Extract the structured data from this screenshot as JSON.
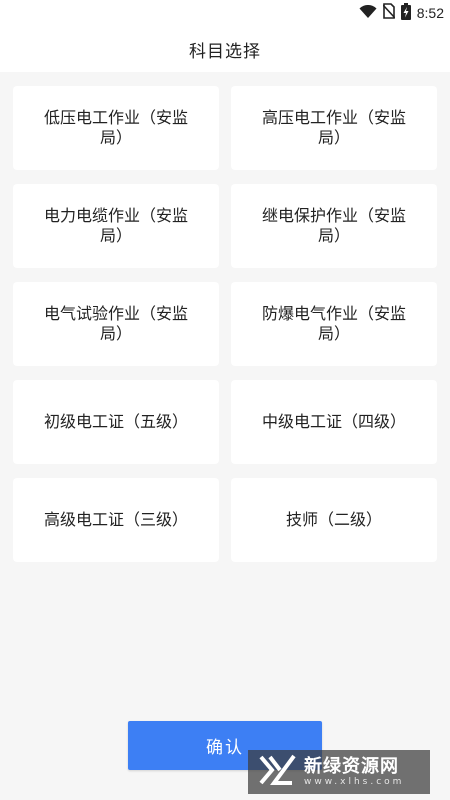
{
  "status_bar": {
    "time": "8:52",
    "icons": [
      "wifi-icon",
      "no-sim-icon",
      "battery-charging-icon"
    ]
  },
  "header": {
    "title": "科目选择"
  },
  "subjects": [
    {
      "label": "低压电工作业（安监局）"
    },
    {
      "label": "高压电工作业（安监局）"
    },
    {
      "label": "电力电缆作业（安监局）"
    },
    {
      "label": "继电保护作业（安监局）"
    },
    {
      "label": "电气试验作业（安监局）"
    },
    {
      "label": "防爆电气作业（安监局）"
    },
    {
      "label": "初级电工证（五级）"
    },
    {
      "label": "中级电工证（四级）"
    },
    {
      "label": "高级电工证（三级）"
    },
    {
      "label": "技师（二级）"
    }
  ],
  "confirm": {
    "label": "确认"
  },
  "watermark": {
    "main": "新绿资源网",
    "sub": "www.xlhs.com"
  },
  "colors": {
    "accent": "#3d7ff4",
    "background": "#f6f6f6",
    "card": "#ffffff"
  }
}
